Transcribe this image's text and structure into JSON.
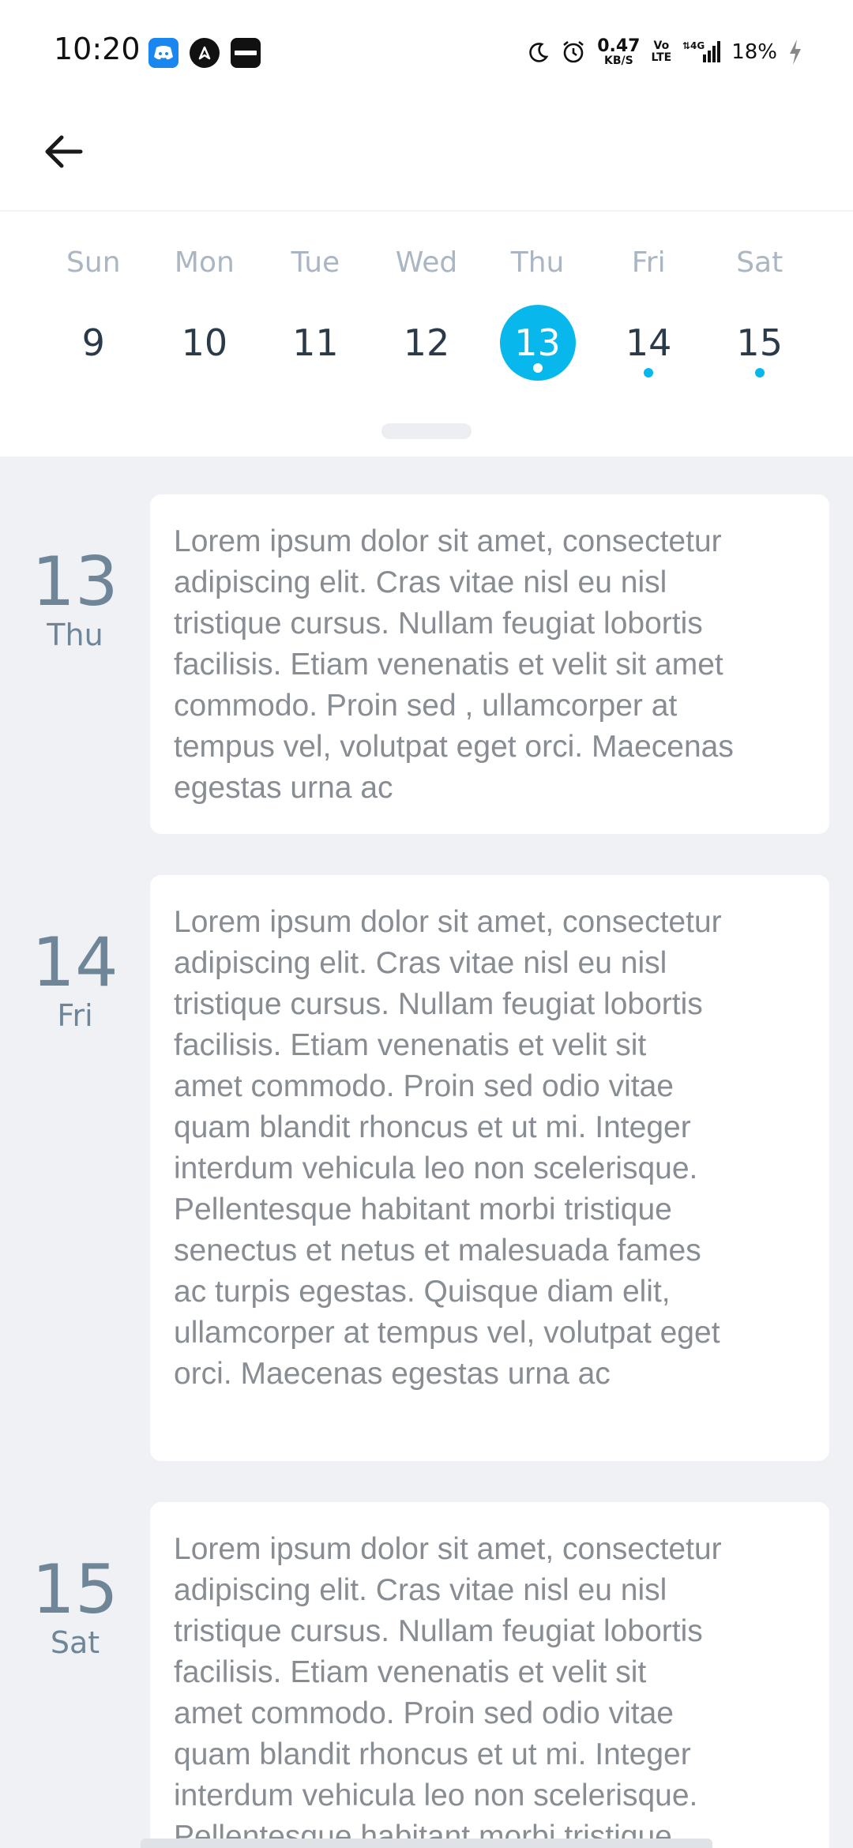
{
  "status_bar": {
    "time": "10:20",
    "speed_value": "0.47",
    "speed_unit": "KB/S",
    "volte_top": "Vo",
    "volte_bottom": "LTE",
    "network": "4G",
    "battery": "18%",
    "icons": [
      "discord-icon",
      "navigation-icon",
      "paytm-icon",
      "moon-icon",
      "alarm-icon",
      "signal-icon",
      "charging-icon"
    ]
  },
  "app_bar": {
    "back_icon": "arrow-left-icon"
  },
  "week": {
    "days": [
      {
        "name": "Sun",
        "num": "9",
        "selected": false,
        "has_event": false
      },
      {
        "name": "Mon",
        "num": "10",
        "selected": false,
        "has_event": false
      },
      {
        "name": "Tue",
        "num": "11",
        "selected": false,
        "has_event": false
      },
      {
        "name": "Wed",
        "num": "12",
        "selected": false,
        "has_event": false
      },
      {
        "name": "Thu",
        "num": "13",
        "selected": true,
        "has_event": true
      },
      {
        "name": "Fri",
        "num": "14",
        "selected": false,
        "has_event": true
      },
      {
        "name": "Sat",
        "num": "15",
        "selected": false,
        "has_event": true
      }
    ],
    "accent_color": "#08b8ec"
  },
  "agenda": [
    {
      "date": "13",
      "day": "Thu",
      "text": "Lorem ipsum dolor sit amet, consectetur\nadipiscing elit. Cras vitae nisl eu nisl\ntristique cursus. Nullam feugiat lobortis\nfacilisis. Etiam venenatis et velit sit amet\ncommodo. Proin sed , ullamcorper at\ntempus vel, volutpat eget orci. Maecenas\negestas urna ac"
    },
    {
      "date": "14",
      "day": "Fri",
      "text": "Lorem ipsum dolor sit amet, consectetur\nadipiscing elit. Cras vitae nisl eu nisl\ntristique cursus. Nullam feugiat lobortis\nfacilisis. Etiam venenatis et velit sit\namet commodo. Proin sed odio vitae\nquam blandit rhoncus et ut mi. Integer\ninterdum vehicula leo non scelerisque.\nPellentesque habitant morbi tristique\nsenectus et netus et malesuada fames\nac turpis egestas. Quisque diam elit,\nullamcorper at tempus vel, volutpat eget\norci. Maecenas egestas urna ac"
    },
    {
      "date": "15",
      "day": "Sat",
      "text": "Lorem ipsum dolor sit amet, consectetur\nadipiscing elit. Cras vitae nisl eu nisl\ntristique cursus. Nullam feugiat lobortis\nfacilisis. Etiam venenatis et velit sit\namet commodo. Proin sed odio vitae\nquam blandit rhoncus et ut mi. Integer\ninterdum vehicula leo non scelerisque.\nPellentesque habitant morbi tristique"
    }
  ]
}
